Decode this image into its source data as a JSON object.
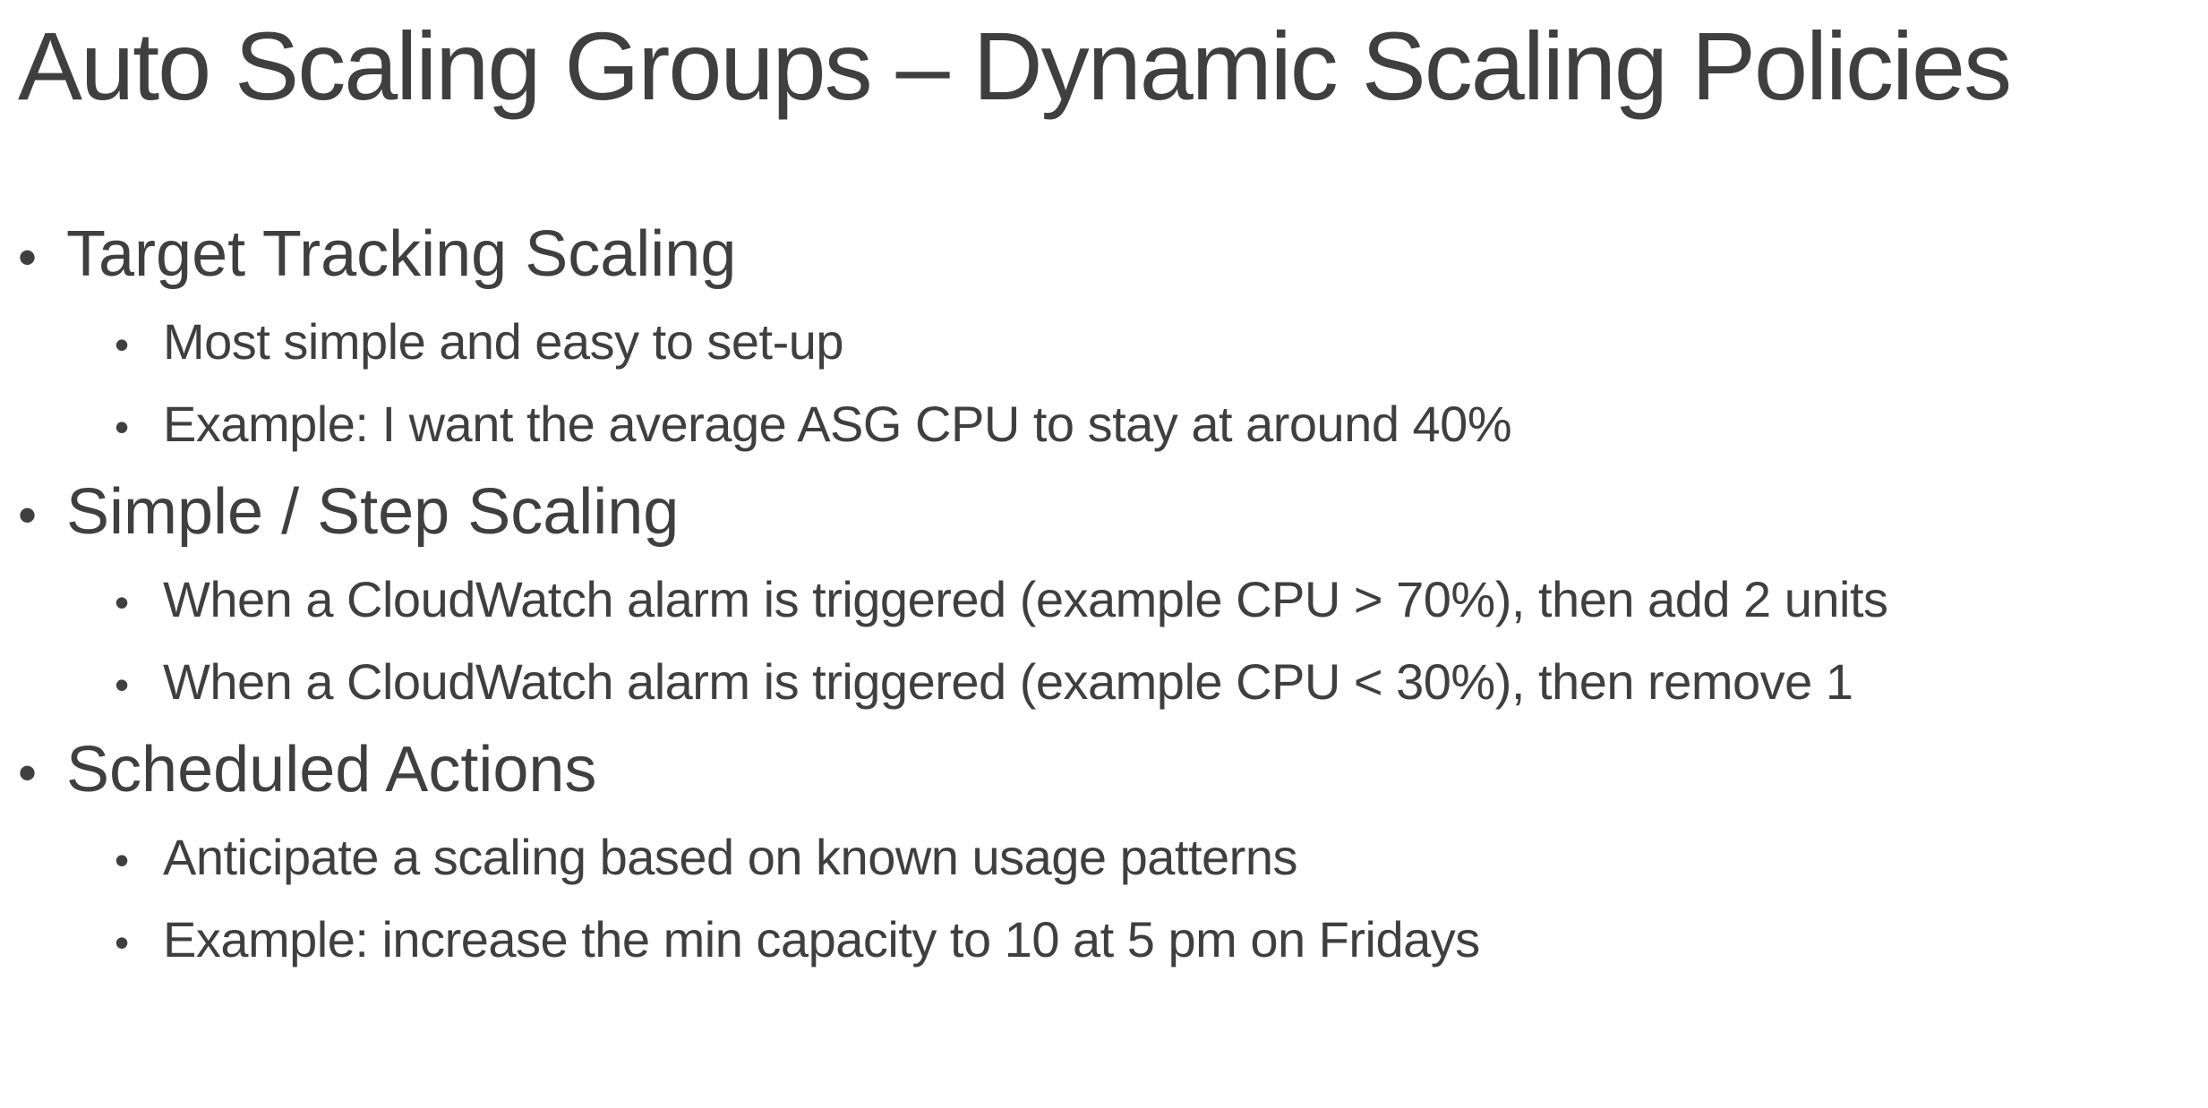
{
  "title": "Auto Scaling Groups – Dynamic Scaling Policies",
  "bullet_glyph": "•",
  "sections": [
    {
      "heading": "Target Tracking Scaling",
      "items": [
        "Most simple and easy to set-up",
        "Example: I want the average ASG CPU to stay at around 40%"
      ]
    },
    {
      "heading": "Simple / Step Scaling",
      "items": [
        "When a CloudWatch alarm is triggered (example CPU > 70%), then add 2 units",
        "When a CloudWatch alarm is triggered (example CPU < 30%), then remove 1"
      ]
    },
    {
      "heading": "Scheduled Actions",
      "items": [
        "Anticipate a scaling based on known usage patterns",
        "Example: increase the min capacity to 10 at 5 pm on Fridays"
      ]
    }
  ]
}
